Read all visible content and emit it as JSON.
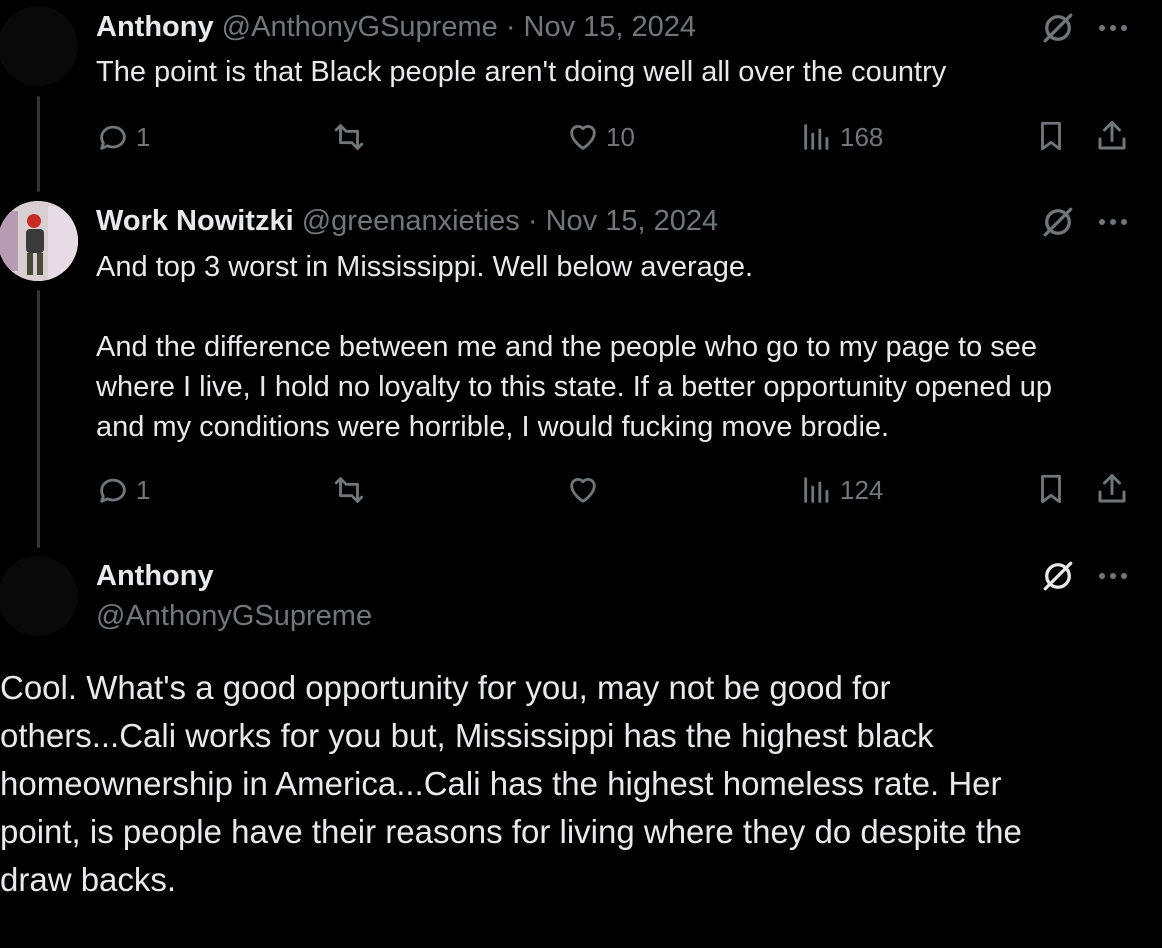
{
  "reply1": {
    "name": "Anthony",
    "handle": "@AnthonyGSupreme",
    "separator": "·",
    "date": "Nov 15, 2024",
    "text": "The point is that Black people aren't doing well all over the country",
    "replies": "1",
    "likes": "10",
    "views": "168"
  },
  "reply2": {
    "name": "Work Nowitzki",
    "handle": "@greenanxieties",
    "separator": "·",
    "date": "Nov 15, 2024",
    "text_lines": [
      "And top 3 worst in Mississippi. Well below average.",
      "And the difference between me and the people who go to my page to see",
      "where I live, I hold no loyalty to this state. If a better opportunity opened up",
      "and my conditions were horrible, I would fucking move brodie."
    ],
    "replies": "1",
    "views": "124"
  },
  "main_post": {
    "name": "Anthony",
    "handle": "@AnthonyGSupreme",
    "text_lines": [
      "Cool. What's a good opportunity for you, may not be good for",
      "others...Cali works for you but, Mississippi has the highest black",
      "homeownership in America...Cali has the highest homeless rate. Her",
      "point, is people have their reasons for living where they do despite the",
      "draw backs."
    ]
  },
  "icons": {
    "grok": "grok-icon",
    "more": "more-icon",
    "reply": "reply-icon",
    "repost": "repost-icon",
    "like": "like-icon",
    "views": "views-icon",
    "bookmark": "bookmark-icon",
    "share": "share-icon"
  },
  "colors": {
    "background": "#000000",
    "text": "#e7e9ea",
    "secondary": "#71767b",
    "thread_line": "#333639"
  }
}
